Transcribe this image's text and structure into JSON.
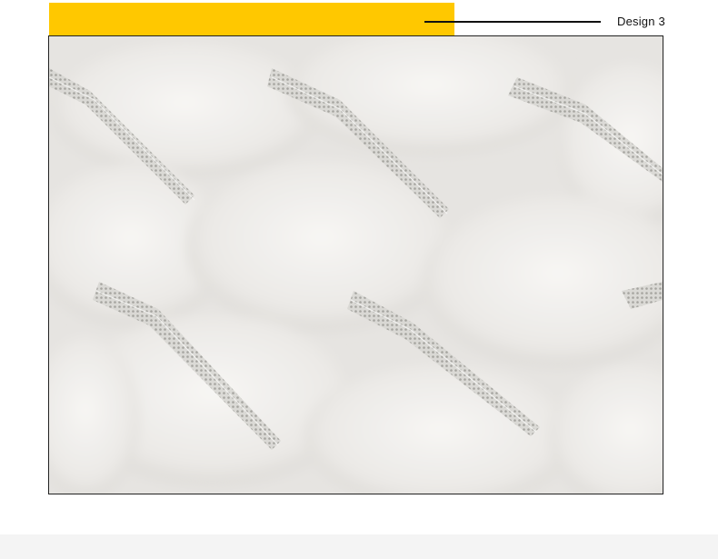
{
  "header": {
    "title": "Design 3",
    "accent_color": "#ffc800"
  },
  "photo": {
    "subject": "quilted-down-fabric-closeup",
    "fabric_color": "#ecebe8",
    "stitch_color": "#b9b9b4"
  },
  "footer": {
    "band_color": "#f4f4f4"
  }
}
